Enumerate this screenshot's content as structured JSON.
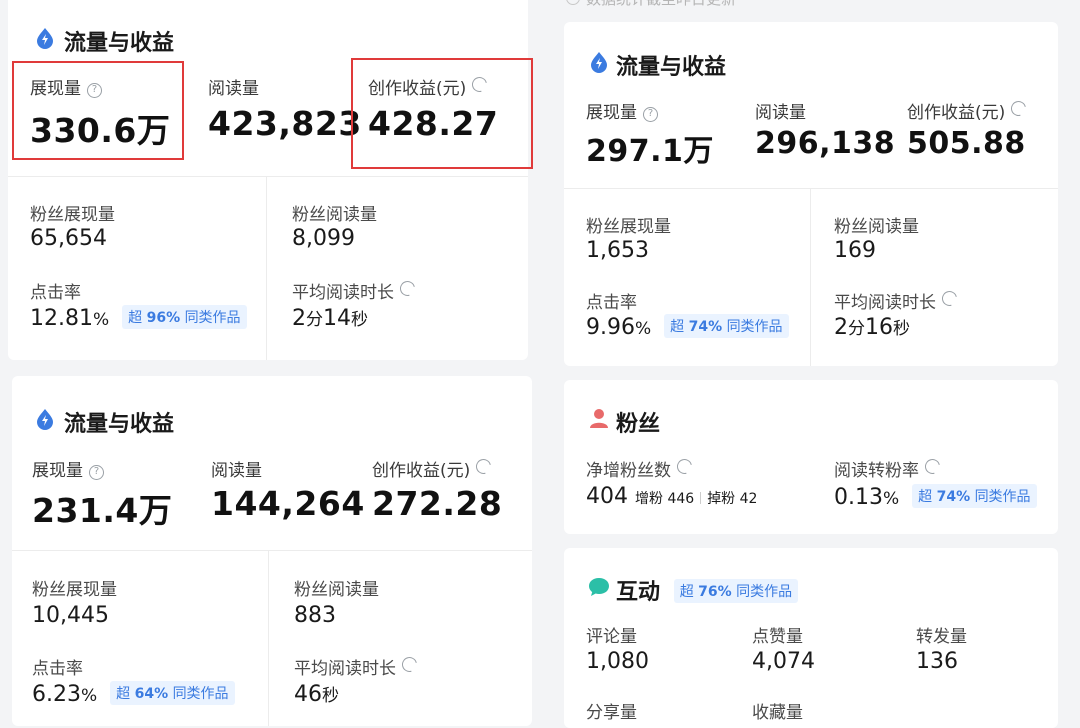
{
  "top_hint": "数据统计截至昨日更新",
  "card1": {
    "title": "流量与收益",
    "impressions_label": "展现量",
    "impressions_value": "330.6万",
    "reads_label": "阅读量",
    "reads_value": "423,823",
    "earnings_label": "创作收益(元)",
    "earnings_value": "428.27",
    "fan_impr_label": "粉丝展现量",
    "fan_impr_value": "65,654",
    "fan_reads_label": "粉丝阅读量",
    "fan_reads_value": "8,099",
    "ctr_label": "点击率",
    "ctr_value": "12.81",
    "ctr_unit": "%",
    "ctr_badge_prefix": "超",
    "ctr_badge_pct": "96%",
    "ctr_badge_suffix": "同类作品",
    "avg_time_label": "平均阅读时长",
    "avg_time_min": "2",
    "avg_time_min_unit": "分",
    "avg_time_sec": "14",
    "avg_time_sec_unit": "秒"
  },
  "card2": {
    "title": "流量与收益",
    "impressions_label": "展现量",
    "impressions_value": "231.4万",
    "reads_label": "阅读量",
    "reads_value": "144,264",
    "earnings_label": "创作收益(元)",
    "earnings_value": "272.28",
    "fan_impr_label": "粉丝展现量",
    "fan_impr_value": "10,445",
    "fan_reads_label": "粉丝阅读量",
    "fan_reads_value": "883",
    "ctr_label": "点击率",
    "ctr_value": "6.23",
    "ctr_unit": "%",
    "ctr_badge_prefix": "超",
    "ctr_badge_pct": "64%",
    "ctr_badge_suffix": "同类作品",
    "avg_time_label": "平均阅读时长",
    "avg_time_sec": "46",
    "avg_time_sec_unit": "秒"
  },
  "card3": {
    "title": "流量与收益",
    "impressions_label": "展现量",
    "impressions_value": "297.1万",
    "reads_label": "阅读量",
    "reads_value": "296,138",
    "earnings_label": "创作收益(元)",
    "earnings_value": "505.88",
    "fan_impr_label": "粉丝展现量",
    "fan_impr_value": "1,653",
    "fan_reads_label": "粉丝阅读量",
    "fan_reads_value": "169",
    "ctr_label": "点击率",
    "ctr_value": "9.96",
    "ctr_unit": "%",
    "ctr_badge_prefix": "超",
    "ctr_badge_pct": "74%",
    "ctr_badge_suffix": "同类作品",
    "avg_time_label": "平均阅读时长",
    "avg_time_min": "2",
    "avg_time_min_unit": "分",
    "avg_time_sec": "16",
    "avg_time_sec_unit": "秒"
  },
  "fans_card": {
    "title": "粉丝",
    "net_label": "净增粉丝数",
    "net_value": "404",
    "gain_label": "增粉",
    "gain_value": "446",
    "loss_label": "掉粉",
    "loss_value": "42",
    "conv_label": "阅读转粉率",
    "conv_value": "0.13",
    "conv_unit": "%",
    "conv_badge_prefix": "超",
    "conv_badge_pct": "74%",
    "conv_badge_suffix": "同类作品"
  },
  "interact_card": {
    "title": "互动",
    "badge_prefix": "超",
    "badge_pct": "76%",
    "badge_suffix": "同类作品",
    "comments_label": "评论量",
    "comments_value": "1,080",
    "likes_label": "点赞量",
    "likes_value": "4,074",
    "shares_label": "转发量",
    "shares_value": "136",
    "share_label": "分享量",
    "fav_label": "收藏量"
  },
  "colors": {
    "accent": "#3b7be0",
    "highlight": "#e03a3a",
    "fans_icon": "#e86a6a",
    "interact_icon": "#2bbfa7"
  }
}
